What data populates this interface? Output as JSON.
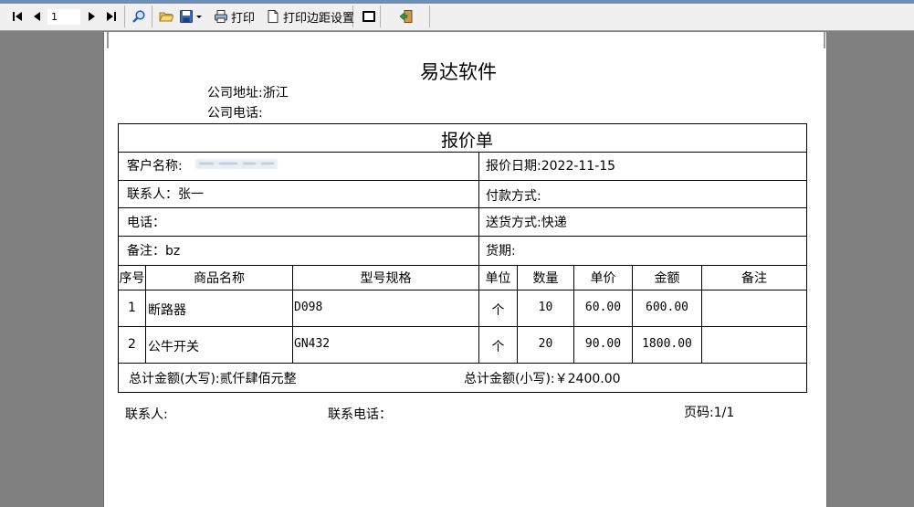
{
  "toolbar": {
    "page_value": "1",
    "print_label": "打印",
    "margin_label": "打印边距设置"
  },
  "report": {
    "company_name": "易达软件",
    "address_label": "公司地址:浙江",
    "phone_label": "公司电话:",
    "doc_title": "报价单",
    "customer_label": "客户名称:",
    "quote_date": "报价日期:2022-11-15",
    "contact": "联系人：张一",
    "payment": "付款方式:",
    "tel": "电话：",
    "delivery": "送货方式:快递",
    "remark": "备注：bz",
    "lead_time": "货期:",
    "columns": [
      "序号",
      "商品名称",
      "型号规格",
      "单位",
      "数量",
      "单价",
      "金额",
      "备注"
    ],
    "rows": [
      [
        "1",
        "断路器",
        "D098",
        "个",
        "10",
        "60.00",
        "600.00",
        ""
      ],
      [
        "2",
        "公牛开关",
        "GN432",
        "个",
        "20",
        "90.00",
        "1800.00",
        ""
      ]
    ],
    "total_upper": "总计金额(大写):贰仟肆佰元整",
    "total_lower": "总计金额(小写):￥2400.00",
    "footer_contact": "联系人:",
    "footer_phone": "联系电话：",
    "footer_page": "页码:1/1"
  }
}
